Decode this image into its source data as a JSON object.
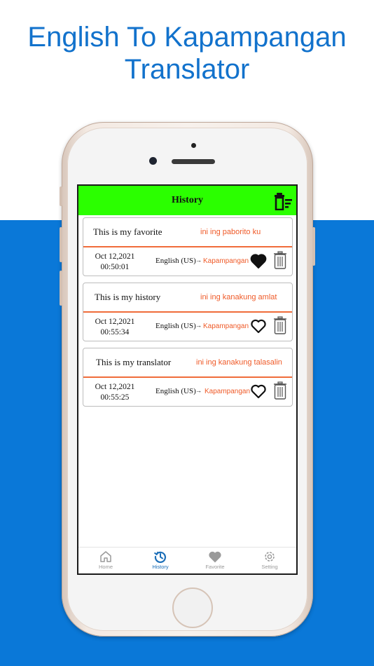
{
  "headline": {
    "line1": "English To Kapampangan",
    "line2": "Translator"
  },
  "colors": {
    "headline": "#1272cc",
    "background_blue": "#0a78d8",
    "header_green": "#2bff00",
    "translation_orange": "#ef5a28",
    "active_tab": "#1d6fb8"
  },
  "screen": {
    "title": "History",
    "clear_icon": "delete-list-icon",
    "items": [
      {
        "source_text": "This is my favorite",
        "translated_text": "ini ing paborito ku",
        "date": "Oct 12,2021",
        "time": "00:50:01",
        "from_language": "English (US)",
        "arrow": "→",
        "to_language": "Kapampangan",
        "favorited": true
      },
      {
        "source_text": "This is my history",
        "translated_text": "ini ing kanakung amlat",
        "date": "Oct 12,2021",
        "time": "00:55:34",
        "from_language": "English (US)",
        "arrow": "→",
        "to_language": "Kapampangan",
        "favorited": false
      },
      {
        "source_text": "This is my translator",
        "translated_text": "ini ing kanakung talasalin",
        "date": "Oct 12,2021",
        "time": "00:55:25",
        "from_language": "English (US)",
        "arrow": "→",
        "to_language": "Kapampangan",
        "favorited": false
      }
    ],
    "tabs": [
      {
        "label": "Home",
        "icon": "home-icon",
        "active": false
      },
      {
        "label": "History",
        "icon": "history-icon",
        "active": true
      },
      {
        "label": "Favorite",
        "icon": "heart-icon",
        "active": false
      },
      {
        "label": "Setting",
        "icon": "gear-icon",
        "active": false
      }
    ]
  }
}
